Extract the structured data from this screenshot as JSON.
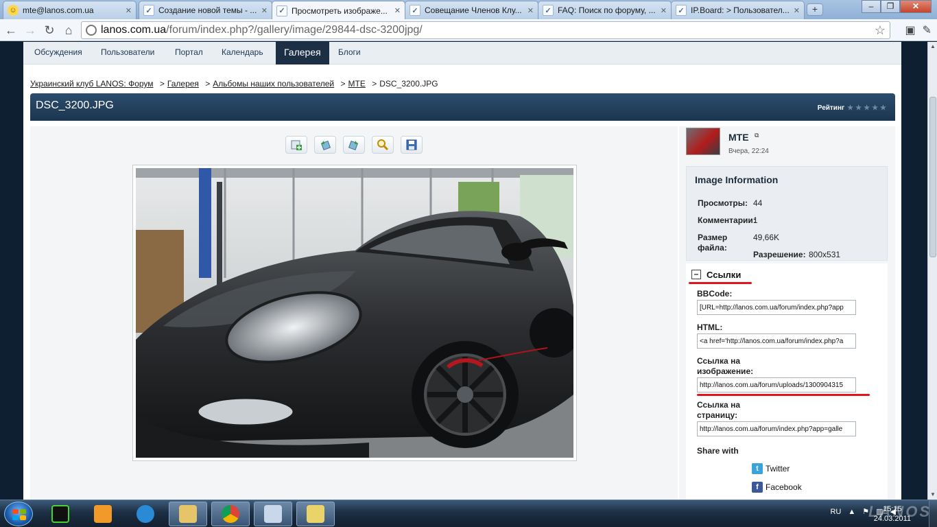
{
  "browser": {
    "tabs": [
      {
        "title": "mte@lanos.com.ua",
        "icon": "mail-icon"
      },
      {
        "title": "Создание новой темы - ...",
        "icon": "ipb-icon"
      },
      {
        "title": "Просмотреть изображе...",
        "icon": "ipb-icon",
        "active": true
      },
      {
        "title": "Совещание Членов Клу...",
        "icon": "ipb-icon"
      },
      {
        "title": "FAQ: Поиск по форуму, ...",
        "icon": "ipb-icon"
      },
      {
        "title": "IP.Board: > Пользовател...",
        "icon": "ipb-icon"
      }
    ],
    "address": {
      "host": "lanos.com.ua",
      "path": "/forum/index.php?/gallery/image/29844-dsc-3200jpg/"
    }
  },
  "nav": {
    "items": [
      "Обсуждения",
      "Пользователи",
      "Портал",
      "Календарь",
      "Галерея",
      "Блоги"
    ],
    "active": "Галерея"
  },
  "breadcrumb": {
    "items": [
      "Украинский клуб LANOS: Форум",
      "Галерея",
      "Альбомы наших пользователей",
      "MTE"
    ],
    "current": "DSC_3200.JPG",
    "separator": ">"
  },
  "image": {
    "title": "DSC_3200.JPG",
    "rating_label": "Рейтинг",
    "rating_stars": "★★★★★",
    "rating_value": 0
  },
  "author": {
    "name": "MTE",
    "date": "Вчера, 22:24"
  },
  "info": {
    "heading": "Image Information",
    "views_label": "Просмотры:",
    "views": "44",
    "comments_label": "Комментарии:",
    "comments": "1",
    "size_label_1": "Размер",
    "size_label_2": "файла:",
    "size": "49,66K",
    "resolution_label": "Разрешение:",
    "resolution": "800x531"
  },
  "links": {
    "heading": "Ссылки",
    "toggle": "–",
    "bbcode_label": "BBCode:",
    "bbcode_value": "[URL=http://lanos.com.ua/forum/index.php?app",
    "html_label": "HTML:",
    "html_value": "<a href='http://lanos.com.ua/forum/index.php?a",
    "img_link_label_1": "Ссылка на",
    "img_link_label_2": "изображение:",
    "img_link_value": "http://lanos.com.ua/forum/uploads/1300904315",
    "page_link_label_1": "Ссылка на",
    "page_link_label_2": "страницу:",
    "page_link_value": "http://lanos.com.ua/forum/index.php?app=galle",
    "share_label": "Share with",
    "twitter": "Twitter",
    "facebook": "Facebook"
  },
  "taskbar": {
    "lang": "RU",
    "time": "15:15",
    "date": "24.03.2011",
    "watermark": "LANOS"
  },
  "colors": {
    "header_dark": "#1c3550",
    "nav_active": "#1c2f45",
    "annotation_red": "#e0141b"
  }
}
